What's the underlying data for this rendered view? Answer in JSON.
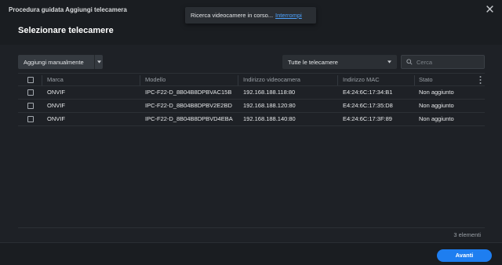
{
  "window": {
    "title": "Procedura guidata Aggiungi telecamera"
  },
  "page": {
    "title": "Selezionare telecamere"
  },
  "toast": {
    "message": "Ricerca videocamere in corso...",
    "link": "Interrompi"
  },
  "toolbar": {
    "add_manual_label": "Aggiungi manualmente",
    "filter_value": "Tutte le telecamere",
    "search_placeholder": "Cerca"
  },
  "table": {
    "headers": [
      "Marca",
      "Modello",
      "Indirizzo videocamera",
      "Indirizzo MAC",
      "Stato"
    ],
    "rows": [
      {
        "brand": "ONVIF",
        "model": "IPC-F22-D_8B04B8DPBVAC15B",
        "ip": "192.168.188.118:80",
        "mac": "E4:24:6C:17:34:B1",
        "status": "Non aggiunto"
      },
      {
        "brand": "ONVIF",
        "model": "IPC-F22-D_8B04B8DPBV2E2BD",
        "ip": "192.168.188.120:80",
        "mac": "E4:24:6C:17:35:D8",
        "status": "Non aggiunto"
      },
      {
        "brand": "ONVIF",
        "model": "IPC-F22-D_8B04B8DPBVD4EBA",
        "ip": "192.168.188.140:80",
        "mac": "E4:24:6C:17:3F:89",
        "status": "Non aggiunto"
      }
    ]
  },
  "footer": {
    "count": "3 elementi",
    "next_label": "Avanti"
  },
  "colors": {
    "accent": "#1e7ef0",
    "link": "#4da3ff",
    "background": "#1e2126"
  },
  "icons": [
    "close-icon",
    "chevron-down-icon",
    "search-icon",
    "kebab-icon"
  ]
}
